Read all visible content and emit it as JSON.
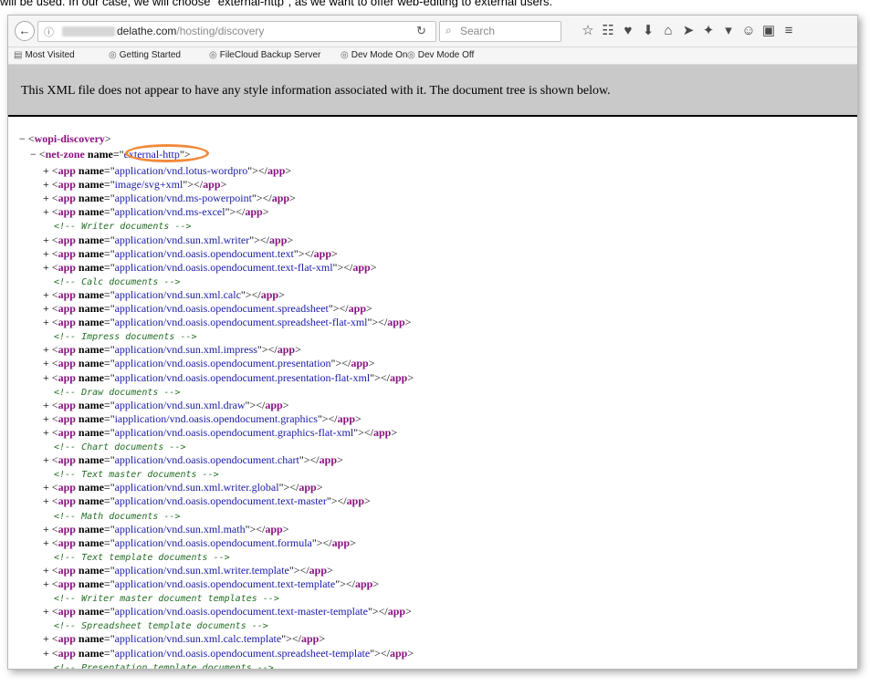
{
  "caption": "will be used. In our case, we will choose \"external-http\", as we want to offer web-editing to external users.",
  "browser": {
    "url_domain": "delathe.com",
    "url_path": "/hosting/discovery",
    "search_placeholder": "Search",
    "bookmarks": [
      "Most Visited",
      "Getting Started",
      "FileCloud Backup Server",
      "Dev Mode On",
      "Dev Mode Off"
    ]
  },
  "xml_info": "This XML file does not appear to have any style information associated with it. The document tree is shown below.",
  "tree": {
    "root_tag": "wopi-discovery",
    "zone_tag": "net-zone",
    "zone_attr": "name",
    "zone_value": "external-http",
    "lines": [
      {
        "t": "app",
        "v": "application/vnd.lotus-wordpro"
      },
      {
        "t": "app",
        "v": "image/svg+xml"
      },
      {
        "t": "app",
        "v": "application/vnd.ms-powerpoint"
      },
      {
        "t": "app",
        "v": "application/vnd.ms-excel"
      },
      {
        "t": "c",
        "v": "<!-- Writer documents -->"
      },
      {
        "t": "app",
        "v": "application/vnd.sun.xml.writer"
      },
      {
        "t": "app",
        "v": "application/vnd.oasis.opendocument.text"
      },
      {
        "t": "app",
        "v": "application/vnd.oasis.opendocument.text-flat-xml"
      },
      {
        "t": "c",
        "v": "<!-- Calc documents -->"
      },
      {
        "t": "app",
        "v": "application/vnd.sun.xml.calc"
      },
      {
        "t": "app",
        "v": "application/vnd.oasis.opendocument.spreadsheet"
      },
      {
        "t": "app",
        "v": "application/vnd.oasis.opendocument.spreadsheet-flat-xml"
      },
      {
        "t": "c",
        "v": "<!-- Impress documents -->"
      },
      {
        "t": "app",
        "v": "application/vnd.sun.xml.impress"
      },
      {
        "t": "app",
        "v": "application/vnd.oasis.opendocument.presentation"
      },
      {
        "t": "app",
        "v": "application/vnd.oasis.opendocument.presentation-flat-xml"
      },
      {
        "t": "c",
        "v": "<!-- Draw documents -->"
      },
      {
        "t": "app",
        "v": "application/vnd.sun.xml.draw"
      },
      {
        "t": "app",
        "v": "iapplication/vnd.oasis.opendocument.graphics"
      },
      {
        "t": "app",
        "v": "application/vnd.oasis.opendocument.graphics-flat-xml"
      },
      {
        "t": "c",
        "v": "<!-- Chart documents -->"
      },
      {
        "t": "app",
        "v": "application/vnd.oasis.opendocument.chart"
      },
      {
        "t": "c",
        "v": "<!-- Text master documents -->"
      },
      {
        "t": "app",
        "v": "application/vnd.sun.xml.writer.global"
      },
      {
        "t": "app",
        "v": "application/vnd.oasis.opendocument.text-master"
      },
      {
        "t": "c",
        "v": "<!-- Math documents -->"
      },
      {
        "t": "app",
        "v": "application/vnd.sun.xml.math"
      },
      {
        "t": "app",
        "v": "application/vnd.oasis.opendocument.formula"
      },
      {
        "t": "c",
        "v": "<!-- Text template documents -->"
      },
      {
        "t": "app",
        "v": "application/vnd.sun.xml.writer.template"
      },
      {
        "t": "app",
        "v": "application/vnd.oasis.opendocument.text-template"
      },
      {
        "t": "c",
        "v": "<!-- Writer master document templates -->"
      },
      {
        "t": "app",
        "v": "application/vnd.oasis.opendocument.text-master-template"
      },
      {
        "t": "c",
        "v": "<!-- Spreadsheet template documents -->"
      },
      {
        "t": "app",
        "v": "application/vnd.sun.xml.calc.template"
      },
      {
        "t": "app",
        "v": "application/vnd.oasis.opendocument.spreadsheet-template"
      },
      {
        "t": "c",
        "v": "<!-- Presentation template documents -->"
      }
    ]
  },
  "colors": {
    "tag": "#881280",
    "value": "#1a1aa6",
    "comment": "#236e25",
    "highlight": "#f28a3a",
    "info_bar": "#c9c9c9"
  }
}
